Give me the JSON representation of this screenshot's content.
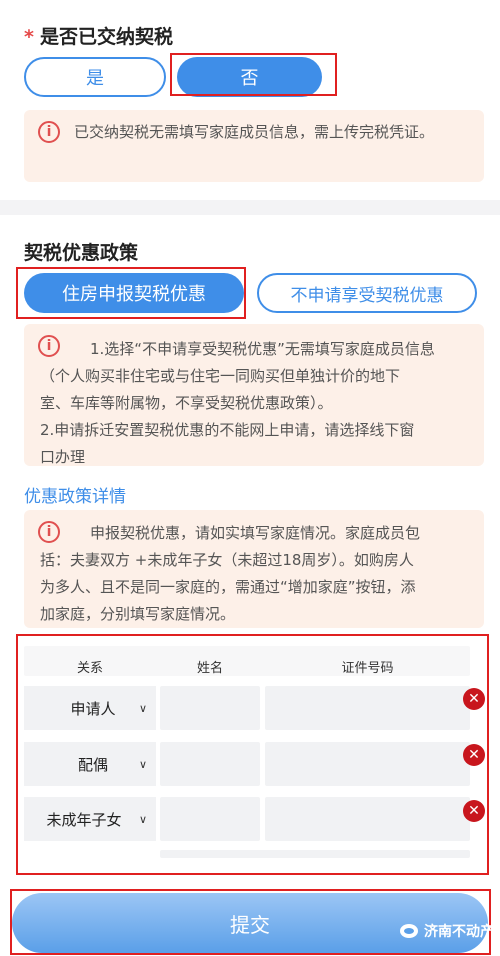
{
  "tax_paid_section": {
    "required_mark": "*",
    "question": "是否已交纳契税",
    "options": [
      "是",
      "否"
    ],
    "selected": "否",
    "notice_icon": "info-icon",
    "notice": "已交纳契税无需填写家庭成员信息，需上传完税凭证。"
  },
  "policy_section": {
    "title": "契税优惠政策",
    "options": [
      "住房申报契税优惠",
      "不申请享受契税优惠"
    ],
    "selected": "住房申报契税优惠",
    "notice_lines": [
      "1.选择“不申请享受契税优惠”无需填写家庭成员信息",
      "（个人购买非住宅或与住宅一同购买但单独计价的地下",
      "室、车库等附属物，不享受契税优惠政策）。",
      "2.申请拆迁安置契税优惠的不能网上申请，请选择线下窗",
      "口办理"
    ],
    "detail_link": "优惠政策详情",
    "detail_notice_lines": [
      "申报契税优惠，请如实填写家庭情况。家庭成员包",
      "括：夫妻双方 +未成年子女（未超过18周岁）。如购房人",
      "为多人、且不是同一家庭的，需通过“增加家庭”按钮，添",
      "加家庭，分别填写家庭情况。"
    ]
  },
  "family_table": {
    "headers": [
      "关系",
      "姓名",
      "证件号码"
    ],
    "rows": [
      {
        "relation": "申请人",
        "name": "",
        "id_number": ""
      },
      {
        "relation": "配偶",
        "name": "",
        "id_number": ""
      },
      {
        "relation": "未成年子女",
        "name": "",
        "id_number": ""
      }
    ],
    "dropdown_icon": "chevron-down-icon",
    "delete_icon": "close-icon"
  },
  "submit_label": "提交",
  "watermark": "济南不动产",
  "colors": {
    "accent": "#3f8ee8",
    "highlight_border": "#e02020",
    "notice_bg": "#fdf0e8",
    "delete_red": "#c8161d"
  }
}
